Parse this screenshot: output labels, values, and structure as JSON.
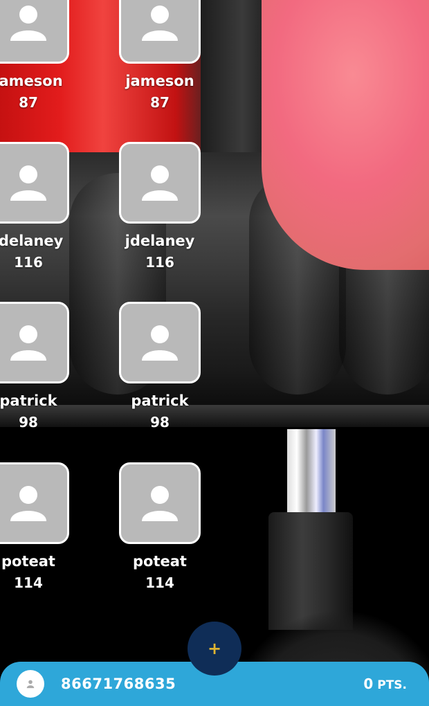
{
  "roster": [
    {
      "name": "jameson",
      "score": "87"
    },
    {
      "name": "jameson",
      "score": "87"
    },
    {
      "name": "jdelaney",
      "score": "116"
    },
    {
      "name": "jdelaney",
      "score": "116"
    },
    {
      "name": "patrick",
      "score": "98"
    },
    {
      "name": "patrick",
      "score": "98"
    },
    {
      "name": "poteat",
      "score": "114"
    },
    {
      "name": "poteat",
      "score": "114"
    }
  ],
  "fab": {
    "icon": "plus-icon",
    "label": "+",
    "color": "#e0b531"
  },
  "footer": {
    "phone": "86671768635",
    "points": "0",
    "points_unit": "PTS.",
    "bar_color": "#2ea7d9"
  }
}
